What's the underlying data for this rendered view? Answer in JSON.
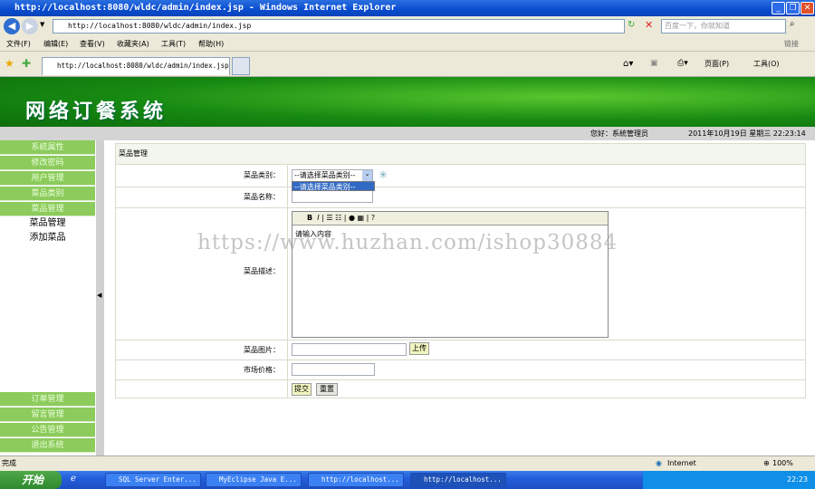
{
  "window": {
    "title": "http://localhost:8080/wldc/admin/index.jsp - Windows Internet Explorer",
    "url": "http://localhost:8080/wldc/admin/index.jsp",
    "search_placeholder": "百度一下，你就知道",
    "links": "链接",
    "tab_title": "http://localhost:8080/wldc/admin/index.jsp",
    "page_menu": "页面(P)",
    "tools_menu": "工具(O)"
  },
  "menu": [
    "文件(F)",
    "编辑(E)",
    "查看(V)",
    "收藏夹(A)",
    "工具(T)",
    "帮助(H)"
  ],
  "banner": {
    "title": "网络订餐系统"
  },
  "infobar": {
    "greeting": "您好：系統管理员",
    "date": "2011年10月19日 星期三 22:23:14"
  },
  "sidebar": {
    "top": [
      "系統属性",
      "修改密码",
      "用户管理",
      "菜品类别",
      "菜品管理"
    ],
    "sub": [
      "菜品管理",
      "添加菜品"
    ],
    "bottom": [
      "订单管理",
      "留言管理",
      "公告管理",
      "退出系统"
    ]
  },
  "form": {
    "header": "菜品管理",
    "category_label": "菜品类别：",
    "category_value": "--请选择菜品类别--",
    "category_option": "--请选择菜品类别--",
    "name_label": "菜品名称：",
    "desc_label": "菜品描述：",
    "desc_placeholder": "请输入内容",
    "image_label": "菜品图片：",
    "upload": "上传",
    "price_label": "市场价格：",
    "submit": "提交",
    "reset": "重置"
  },
  "watermark": "https://www.huzhan.com/ishop30884",
  "status": {
    "text": "完成",
    "zone": "Internet",
    "zoom": "100%"
  },
  "taskbar": {
    "start": "开始",
    "tasks": [
      "SQL Server Enter...",
      "MyEclipse Java E...",
      "http://localhost...",
      "http://localhost..."
    ],
    "clock": "22:23"
  }
}
